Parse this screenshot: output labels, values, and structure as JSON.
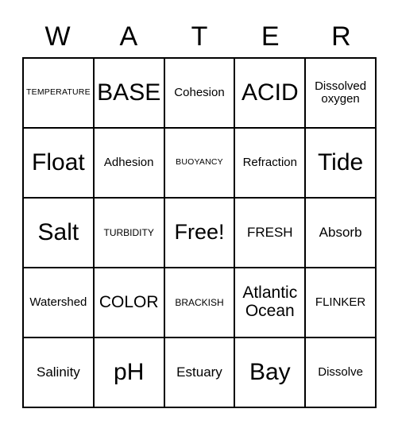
{
  "header": {
    "letters": [
      "W",
      "A",
      "T",
      "E",
      "R"
    ]
  },
  "grid": {
    "rows": 5,
    "columns": 5,
    "border_color": "#000000",
    "background_color": "#ffffff",
    "cells": [
      [
        {
          "text": "TEMPERATURE",
          "size": "xs"
        },
        {
          "text": "BASE",
          "size": "hg"
        },
        {
          "text": "Cohesion",
          "size": "md"
        },
        {
          "text": "ACID",
          "size": "hg"
        },
        {
          "text": "Dissolved\noxygen",
          "size": "md"
        }
      ],
      [
        {
          "text": "Float",
          "size": "hg"
        },
        {
          "text": "Adhesion",
          "size": "md"
        },
        {
          "text": "BUOYANCY",
          "size": "xs"
        },
        {
          "text": "Refraction",
          "size": "md"
        },
        {
          "text": "Tide",
          "size": "hg"
        }
      ],
      [
        {
          "text": "Salt",
          "size": "hg"
        },
        {
          "text": "TURBIDITY",
          "size": "sm"
        },
        {
          "text": "Free!",
          "size": "xxl"
        },
        {
          "text": "FRESH",
          "size": "lg"
        },
        {
          "text": "Absorb",
          "size": "lg"
        }
      ],
      [
        {
          "text": "Watershed",
          "size": "md"
        },
        {
          "text": "COLOR",
          "size": "xl"
        },
        {
          "text": "BRACKISH",
          "size": "sm"
        },
        {
          "text": "Atlantic\nOcean",
          "size": "xl"
        },
        {
          "text": "FLINKER",
          "size": "md"
        }
      ],
      [
        {
          "text": "Salinity",
          "size": "lg"
        },
        {
          "text": "pH",
          "size": "hg"
        },
        {
          "text": "Estuary",
          "size": "lg"
        },
        {
          "text": "Bay",
          "size": "hg"
        },
        {
          "text": "Dissolve",
          "size": "md"
        }
      ]
    ]
  }
}
